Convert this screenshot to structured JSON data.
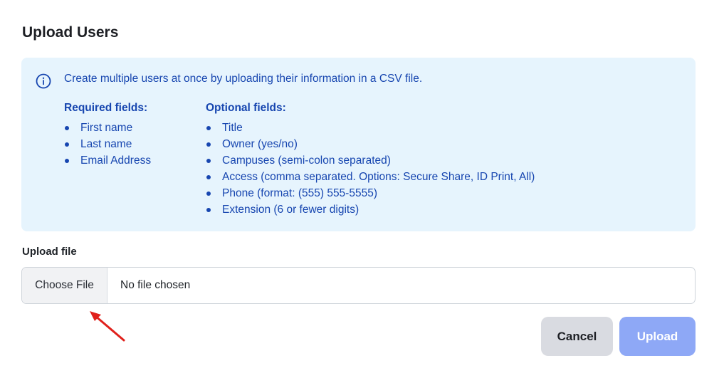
{
  "page": {
    "title": "Upload Users"
  },
  "info": {
    "icon": "info-icon",
    "message": "Create multiple users at once by uploading their information in a CSV file.",
    "required": {
      "heading": "Required fields:",
      "items": [
        "First name",
        "Last name",
        "Email Address"
      ]
    },
    "optional": {
      "heading": "Optional fields:",
      "items": [
        "Title",
        "Owner (yes/no)",
        "Campuses (semi-colon separated)",
        "Access (comma separated. Options: Secure Share, ID Print, All)",
        "Phone (format: (555) 555-5555)",
        "Extension (6 or fewer digits)"
      ]
    }
  },
  "upload": {
    "label": "Upload file",
    "choose_label": "Choose File",
    "status": "No file chosen"
  },
  "actions": {
    "cancel_label": "Cancel",
    "upload_label": "Upload"
  },
  "colors": {
    "info_bg": "#e6f4fd",
    "info_text": "#1746b0",
    "upload_button": "#8ea8f6",
    "cancel_button": "#d9dbe1",
    "annotation_arrow": "#e0201b"
  }
}
